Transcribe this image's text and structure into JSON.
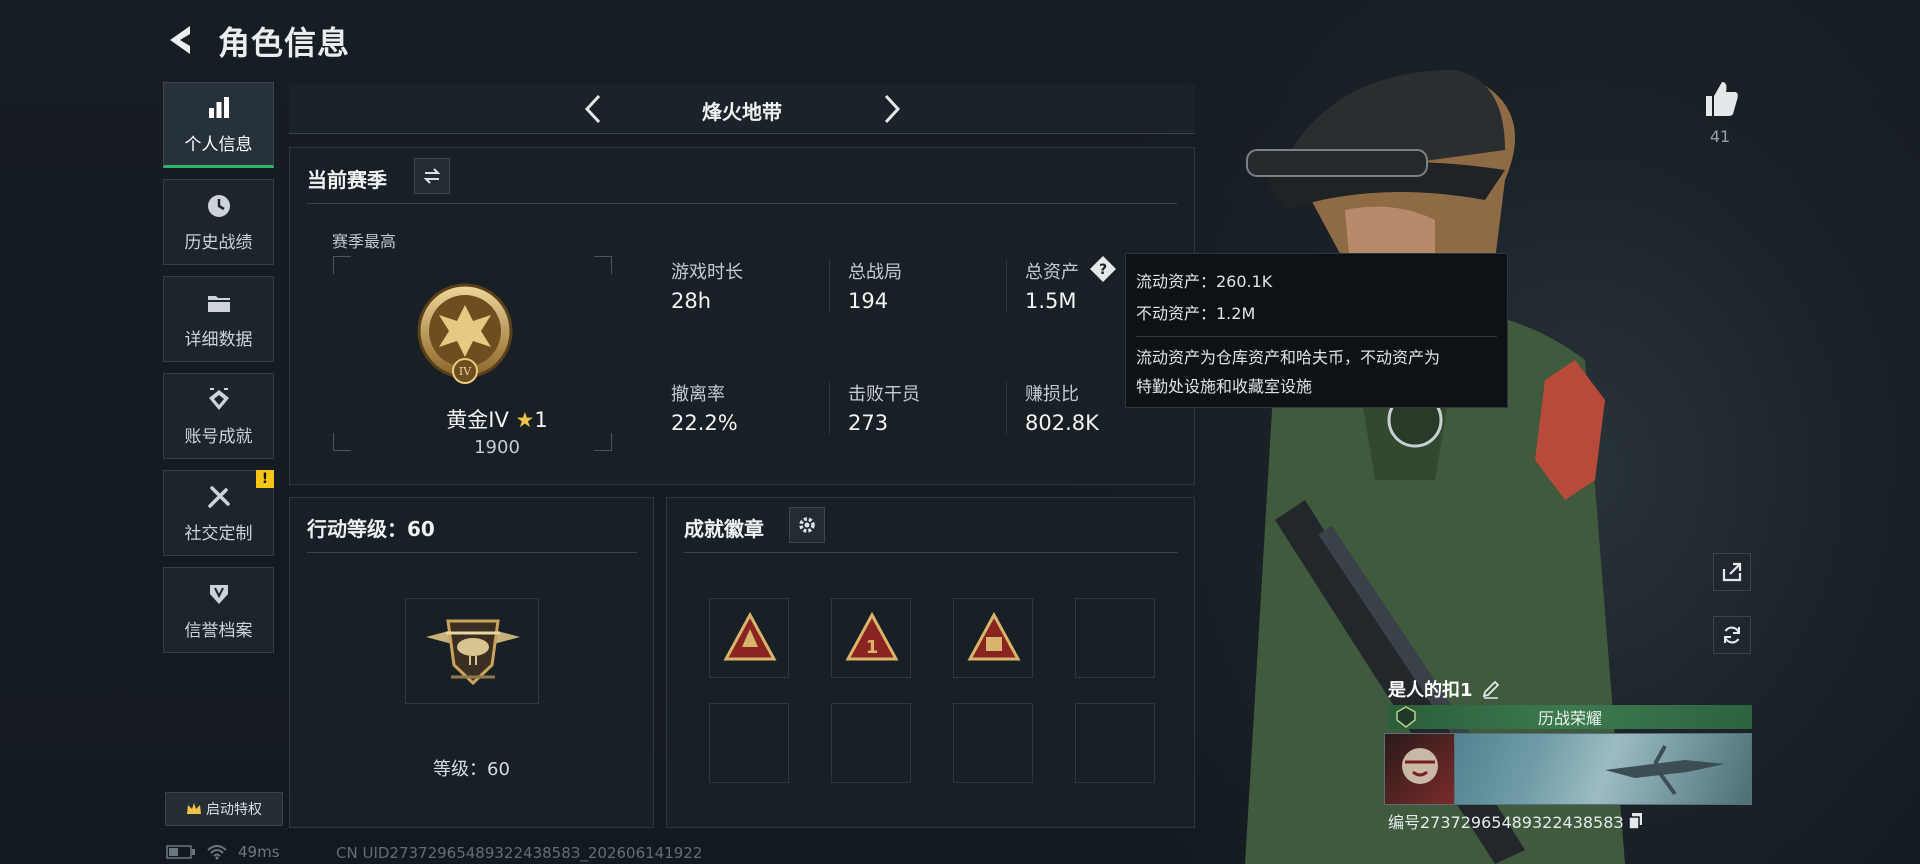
{
  "header": {
    "title": "角色信息"
  },
  "sidebar": {
    "items": [
      {
        "label": "个人信息",
        "icon": "bar-chart-icon",
        "active": true
      },
      {
        "label": "历史战绩",
        "icon": "clock-icon"
      },
      {
        "label": "详细数据",
        "icon": "folder-icon"
      },
      {
        "label": "账号成就",
        "icon": "trophy-icon"
      },
      {
        "label": "社交定制",
        "icon": "tools-icon",
        "alert": "!"
      },
      {
        "label": "信誉档案",
        "icon": "shield-icon"
      }
    ],
    "perk_button": "启动特权"
  },
  "mode": {
    "name": "烽火地带"
  },
  "season": {
    "title": "当前赛季",
    "best_label": "赛季最高",
    "rank_name": "黄金IV",
    "rank_stars": "1",
    "rank_points": "1900",
    "rank_emblem_numeral": "IV",
    "stats": [
      {
        "label": "游戏时长",
        "value": "28h"
      },
      {
        "label": "总战局",
        "value": "194"
      },
      {
        "label": "总资产",
        "value": "1.5M"
      },
      {
        "label": "撤离率",
        "value": "22.2%"
      },
      {
        "label": "击败干员",
        "value": "273"
      },
      {
        "label": "赚损比",
        "value": "802.8K"
      }
    ]
  },
  "tooltip": {
    "liquid": "流动资产：260.1K",
    "fixed": "不动资产：1.2M",
    "desc_1": "流动资产为仓库资产和哈夫币，不动资产为",
    "desc_2": "特勤处设施和收藏室设施"
  },
  "action_level": {
    "title": "行动等级：60",
    "level_text": "等级：60"
  },
  "badges": {
    "title": "成就徽章"
  },
  "profile": {
    "likes": "41",
    "player_name": "是人的扣1",
    "honor": "历战荣耀",
    "id_text": "编号2737296548932243858З"
  },
  "status": {
    "ping": "49ms",
    "uid": "CN UID2737296548932243858З_202606141922"
  },
  "colors": {
    "accent": "#2fb36b",
    "gold": "#c9a45a",
    "alert": "#f5c518"
  }
}
